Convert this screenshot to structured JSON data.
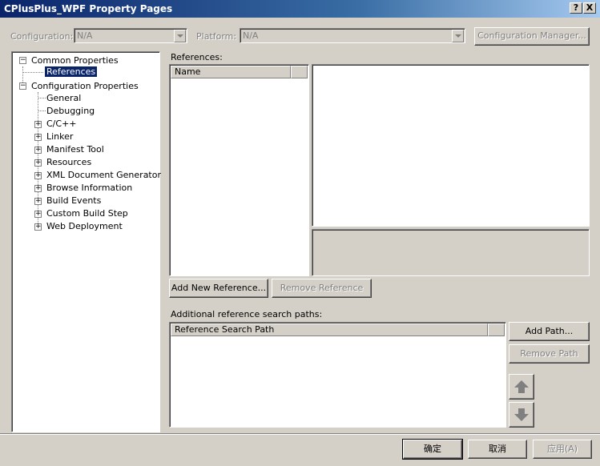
{
  "window": {
    "title": "CPlusPlus_WPF Property Pages",
    "help_glyph": "?",
    "close_glyph": "X"
  },
  "toolbar": {
    "configuration_label": "Configuration:",
    "configuration_value": "N/A",
    "platform_label": "Platform:",
    "platform_value": "N/A",
    "config_manager_label": "Configuration Manager..."
  },
  "tree": {
    "common_properties": "Common Properties",
    "references": "References",
    "configuration_properties": "Configuration Properties",
    "general": "General",
    "debugging": "Debugging",
    "cpp": "C/C++",
    "linker": "Linker",
    "manifest_tool": "Manifest Tool",
    "resources": "Resources",
    "xml_doc": "XML Document Generator",
    "browse_info": "Browse Information",
    "build_events": "Build Events",
    "custom_build": "Custom Build Step",
    "web_deploy": "Web Deployment"
  },
  "references": {
    "label": "References:",
    "name_header": "Name",
    "add_new": "Add New Reference...",
    "remove": "Remove Reference"
  },
  "search_paths": {
    "label": "Additional reference search paths:",
    "header": "Reference Search Path",
    "add_path": "Add Path...",
    "remove_path": "Remove Path"
  },
  "footer": {
    "ok": "确定",
    "cancel": "取消",
    "apply": "应用(A)"
  }
}
